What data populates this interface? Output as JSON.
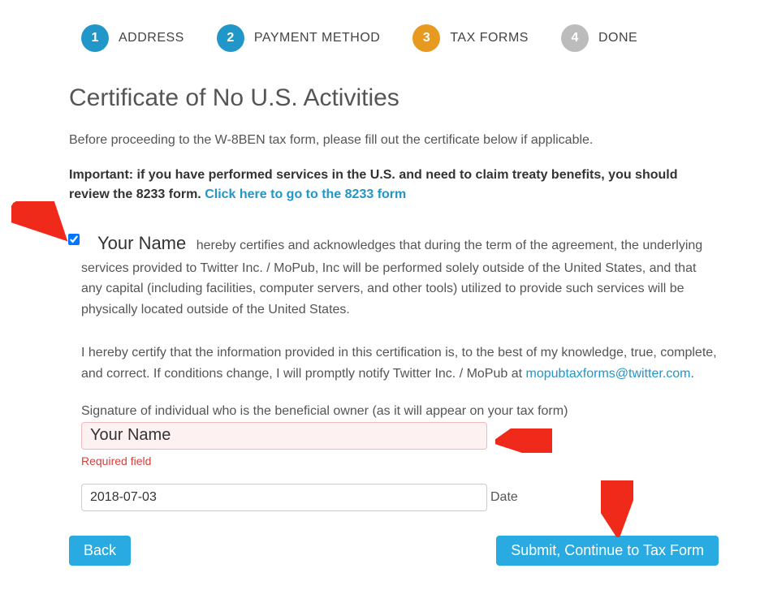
{
  "steps": [
    {
      "num": "1",
      "label": "ADDRESS",
      "colorClass": "bg-blue"
    },
    {
      "num": "2",
      "label": "PAYMENT METHOD",
      "colorClass": "bg-blue"
    },
    {
      "num": "3",
      "label": "TAX FORMS",
      "colorClass": "bg-orange"
    },
    {
      "num": "4",
      "label": "DONE",
      "colorClass": "bg-gray"
    }
  ],
  "heading": "Certificate of No U.S. Activities",
  "intro": "Before proceeding to the W-8BEN tax form, please fill out the certificate below if applicable.",
  "important_prefix": "Important: if you have performed services in the U.S. and need to claim treaty benefits, you should review the 8233 form. ",
  "important_link": "Click here to go to the 8233 form",
  "name_placeholder": "Your Name",
  "cert_text1": " hereby certifies and acknowledges that during the term of the agreement, the underlying services provided to Twitter Inc. / MoPub, Inc will be performed solely outside of the United States, and that any capital (including facilities, computer servers, and other tools) utilized to provide such services will be physically located outside of the United States.",
  "cert_text2_a": "I hereby certify that the information provided in this certification is, to the best of my knowledge, true, complete, and correct. If conditions change, I will promptly notify Twitter Inc. / MoPub at ",
  "cert_email": "mopubtaxforms@twitter.com",
  "cert_text2_b": ".",
  "sig_label": "Signature of individual who is the beneficial owner (as it will appear on your tax form)",
  "sig_value": "Your Name",
  "error_text": "Required field",
  "date_value": "2018-07-03",
  "date_label": "Date",
  "back_label": "Back",
  "submit_label": "Submit, Continue to Tax Form"
}
